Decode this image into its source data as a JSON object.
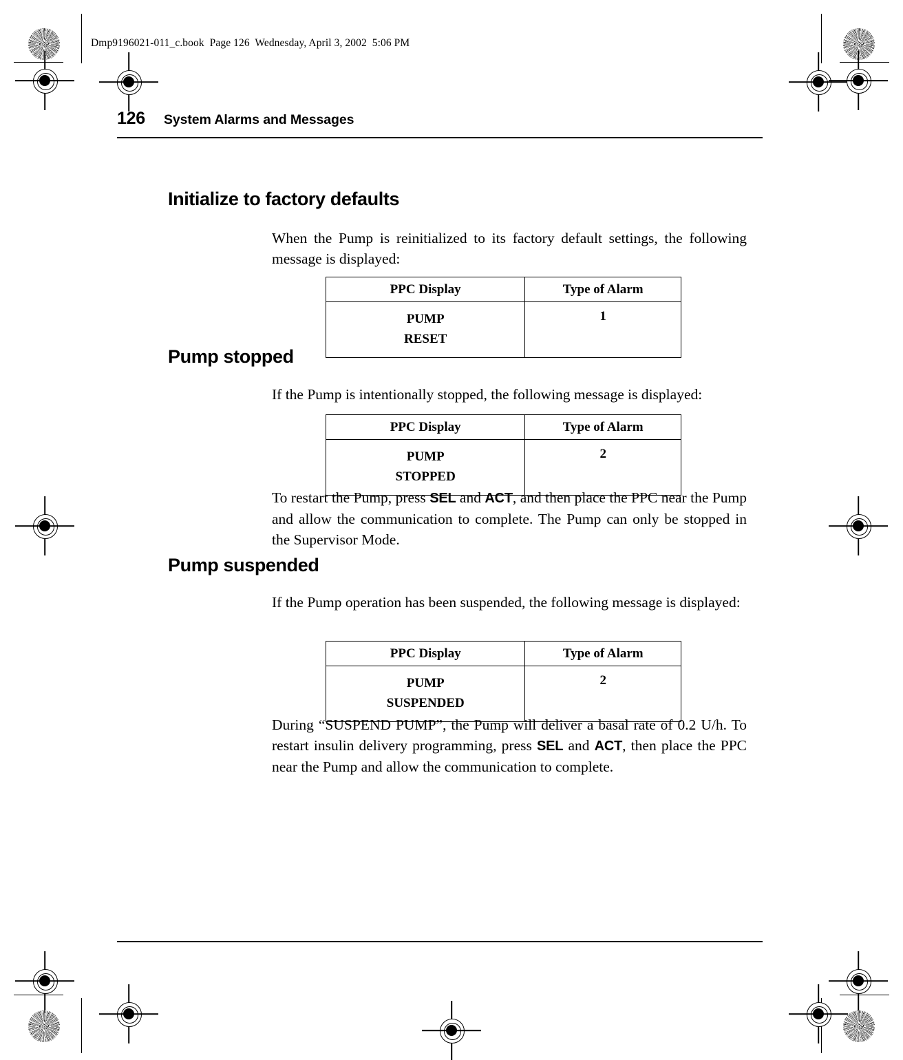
{
  "file_stamp": "Dmp9196021-011_c.book  Page 126  Wednesday, April 3, 2002  5:06 PM",
  "running_head": {
    "folio": "126",
    "chapter_title": "System Alarms and Messages"
  },
  "sections": [
    {
      "heading": "Initialize to factory defaults",
      "paragraph": "When the Pump is reinitialized to its factory default settings, the following message is displayed:",
      "table": {
        "columns": [
          "PPC Display",
          "Type of Alarm"
        ],
        "display_line1": "PUMP",
        "display_line2": "RESET",
        "alarm_type": "1"
      }
    },
    {
      "heading": "Pump stopped",
      "paragraph": "If the Pump is intentionally stopped, the following message is displayed:",
      "table": {
        "columns": [
          "PPC Display",
          "Type of Alarm"
        ],
        "display_line1": "PUMP",
        "display_line2": "STOPPED",
        "alarm_type": "2"
      },
      "after_paragraph": {
        "part1": "To restart the Pump, press ",
        "key1": "SEL",
        "part2": " and ",
        "key2": "ACT",
        "part3": ", and then place the PPC near the Pump and allow the communication to complete. The Pump can only be stopped in the Supervisor Mode."
      }
    },
    {
      "heading": "Pump suspended",
      "paragraph": "If the Pump operation has been suspended, the following message is displayed:",
      "table": {
        "columns": [
          "PPC Display",
          "Type of Alarm"
        ],
        "display_line1": "PUMP",
        "display_line2": "SUSPENDED",
        "alarm_type": "2"
      },
      "after_paragraph": {
        "part1": "During “SUSPEND PUMP”, the Pump will deliver a basal rate of 0.2 U/h. To restart insulin delivery programming, press ",
        "key1": "SEL",
        "part2": " and ",
        "key2": "ACT",
        "part3": ", then place the PPC near the Pump and allow the communication to complete."
      }
    }
  ]
}
